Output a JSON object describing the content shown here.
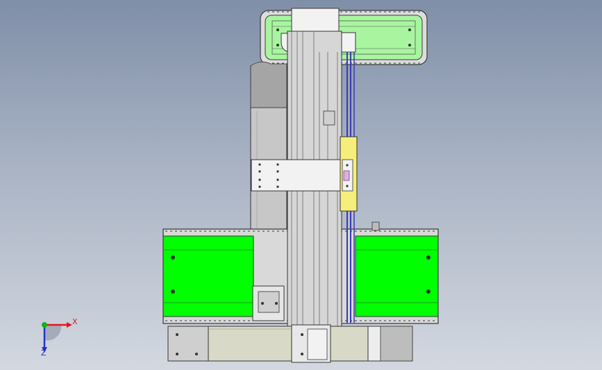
{
  "viewport": {
    "background_top": "#7f8fa8",
    "background_bottom": "#d3d8e0"
  },
  "colors": {
    "green_panel": "#00ff00",
    "light_green": "#a8f5a0",
    "metal": "#c9c9c9",
    "dark_metal": "#7d7d7d",
    "white_plate": "#f2f2f2",
    "yellow_block": "#f5ee7a",
    "blue_cable": "#3b3bb0",
    "edge": "#3a3a3a"
  },
  "triad": {
    "x_label": "X",
    "z_label": "Z",
    "x_color": "#e01818",
    "y_color": "#18b018",
    "z_color": "#2233cc"
  },
  "icons": {
    "triad": "view-orientation-triad-icon"
  }
}
